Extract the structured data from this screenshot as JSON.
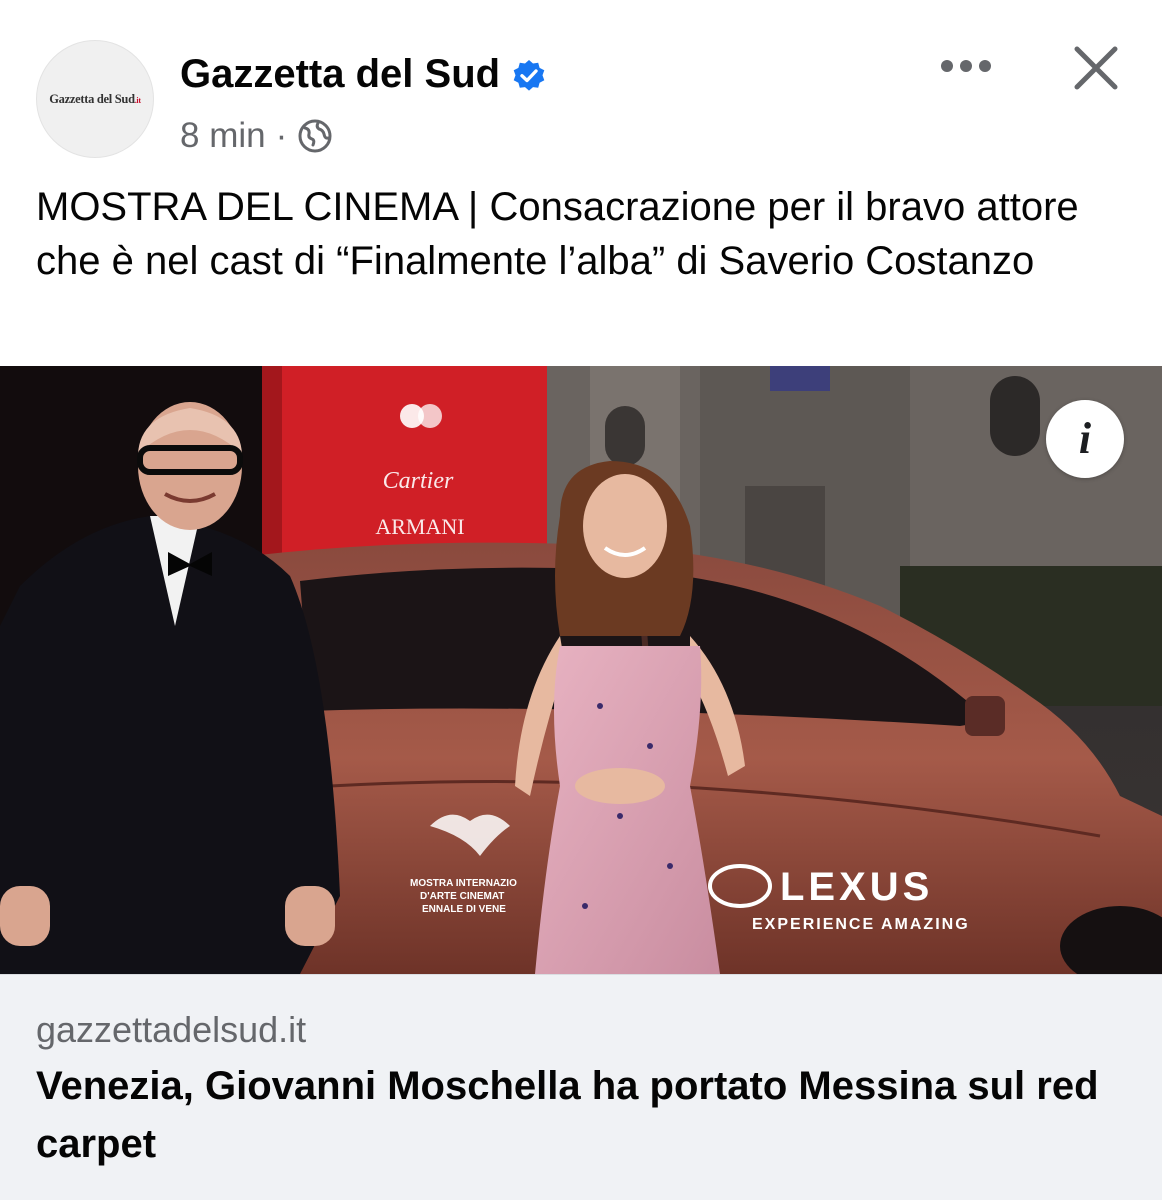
{
  "post": {
    "avatar_label": "Gazzetta del Sud",
    "avatar_tld": ".it",
    "page_name": "Gazzetta del Sud",
    "time": "8 min",
    "separator": "·",
    "text": "MOSTRA DEL CINEMA | Consacrazione per il bravo attore che è nel cast di “Finalmente l’alba” di Saverio Costanzo"
  },
  "photo": {
    "signage": [
      "Cartier",
      "ARMANI"
    ],
    "car_brand": "LEXUS",
    "car_tagline": "EXPERIENCE AMAZING",
    "door_decal": [
      "MOSTRA INTERNAZIO",
      "D'ARTE CINEMAT",
      "ENNALE DI VENE"
    ]
  },
  "link": {
    "domain": "gazzettadelsud.it",
    "title": "Venezia, Giovanni Moschella ha portato Messina sul red carpet"
  },
  "colors": {
    "verified": "#1877f2",
    "secondary_text": "#65676b",
    "footer_bg": "#f0f2f5",
    "brand_red": "#c8102e"
  },
  "icons": {
    "verified": "verified-badge-icon",
    "privacy": "globe-icon",
    "more": "more-dots-icon",
    "close": "close-icon",
    "info": "info-icon"
  }
}
